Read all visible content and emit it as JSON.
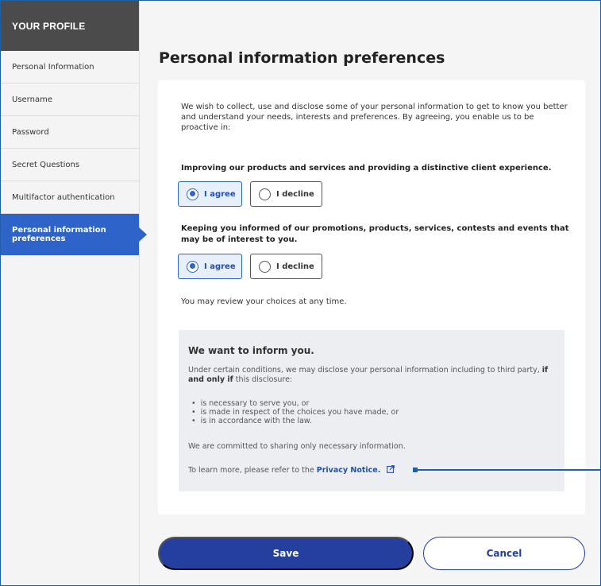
{
  "sidebar": {
    "header": "YOUR PROFILE",
    "items": [
      {
        "label": "Personal Information"
      },
      {
        "label": "Username"
      },
      {
        "label": "Password"
      },
      {
        "label": "Secret Questions"
      },
      {
        "label": "Multifactor authentication"
      },
      {
        "label": "Personal information preferences",
        "active": true
      }
    ]
  },
  "main": {
    "title": "Personal information preferences",
    "intro": "We wish to collect, use and disclose some of your personal information to get to know you better and understand your needs, interests and preferences. By agreeing, you enable us to be proactive in:",
    "questions": [
      {
        "text": "Improving our products and services and providing a distinctive client experience.",
        "agree_label": "I agree",
        "decline_label": "I decline",
        "selected": "agree"
      },
      {
        "text": "Keeping you informed of our promotions, products, services, contests and events that may be of interest to you.",
        "agree_label": "I agree",
        "decline_label": "I decline",
        "selected": "agree"
      }
    ],
    "review_note": "You may review your choices at any time.",
    "info": {
      "title": "We want to inform you.",
      "para1_start": "Under certain conditions, we may disclose your personal information including to third party,",
      "para1_bold": "if and only if",
      "para1_end": "this disclosure:",
      "list": [
        "is necessary to serve you, or",
        "is made in respect of the choices you have made, or",
        "is in accordance with the law."
      ],
      "para2": "We are committed to sharing only necessary information.",
      "para3_start": "To learn more, please refer to the",
      "privacy_link": "Privacy Notice."
    }
  },
  "buttons": {
    "save": "Save",
    "cancel": "Cancel"
  },
  "colors": {
    "accent": "#2e63c9",
    "button_primary": "#243f9d",
    "sidebar_header": "#4b4b4b"
  }
}
